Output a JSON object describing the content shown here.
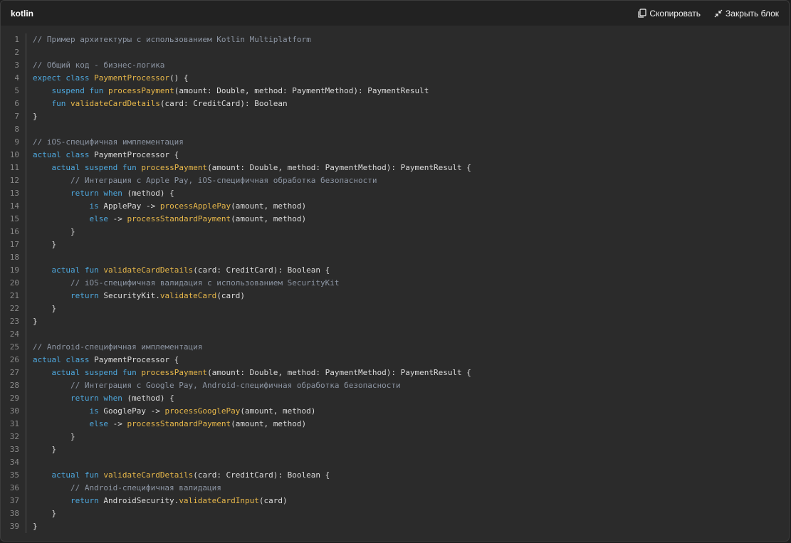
{
  "header": {
    "language": "kotlin",
    "copy_label": "Скопировать",
    "close_label": "Закрыть блок"
  },
  "code": {
    "lines": [
      [
        {
          "t": "c",
          "v": "// Пример архитектуры с использованием Kotlin Multiplatform"
        }
      ],
      [],
      [
        {
          "t": "c",
          "v": "// Общий код - бизнес-логика"
        }
      ],
      [
        {
          "t": "k",
          "v": "expect class "
        },
        {
          "t": "f",
          "v": "PaymentProcessor"
        },
        {
          "t": "p",
          "v": "() {"
        }
      ],
      [
        {
          "t": "p",
          "v": "    "
        },
        {
          "t": "k",
          "v": "suspend fun "
        },
        {
          "t": "f",
          "v": "processPayment"
        },
        {
          "t": "p",
          "v": "(amount: Double, method: PaymentMethod): PaymentResult"
        }
      ],
      [
        {
          "t": "p",
          "v": "    "
        },
        {
          "t": "k",
          "v": "fun "
        },
        {
          "t": "f",
          "v": "validateCardDetails"
        },
        {
          "t": "p",
          "v": "(card: CreditCard): Boolean"
        }
      ],
      [
        {
          "t": "p",
          "v": "}"
        }
      ],
      [],
      [
        {
          "t": "c",
          "v": "// iOS-специфичная имплементация"
        }
      ],
      [
        {
          "t": "k",
          "v": "actual class "
        },
        {
          "t": "p",
          "v": "PaymentProcessor {"
        }
      ],
      [
        {
          "t": "p",
          "v": "    "
        },
        {
          "t": "k",
          "v": "actual suspend fun "
        },
        {
          "t": "f",
          "v": "processPayment"
        },
        {
          "t": "p",
          "v": "(amount: Double, method: PaymentMethod): PaymentResult {"
        }
      ],
      [
        {
          "t": "p",
          "v": "        "
        },
        {
          "t": "c",
          "v": "// Интеграция с Apple Pay, iOS-специфичная обработка безопасности"
        }
      ],
      [
        {
          "t": "p",
          "v": "        "
        },
        {
          "t": "k",
          "v": "return when "
        },
        {
          "t": "p",
          "v": "(method) {"
        }
      ],
      [
        {
          "t": "p",
          "v": "            "
        },
        {
          "t": "k",
          "v": "is "
        },
        {
          "t": "p",
          "v": "ApplePay -> "
        },
        {
          "t": "f",
          "v": "processApplePay"
        },
        {
          "t": "p",
          "v": "(amount, method)"
        }
      ],
      [
        {
          "t": "p",
          "v": "            "
        },
        {
          "t": "k",
          "v": "else "
        },
        {
          "t": "p",
          "v": "-> "
        },
        {
          "t": "f",
          "v": "processStandardPayment"
        },
        {
          "t": "p",
          "v": "(amount, method)"
        }
      ],
      [
        {
          "t": "p",
          "v": "        }"
        }
      ],
      [
        {
          "t": "p",
          "v": "    }"
        }
      ],
      [],
      [
        {
          "t": "p",
          "v": "    "
        },
        {
          "t": "k",
          "v": "actual fun "
        },
        {
          "t": "f",
          "v": "validateCardDetails"
        },
        {
          "t": "p",
          "v": "(card: CreditCard): Boolean {"
        }
      ],
      [
        {
          "t": "p",
          "v": "        "
        },
        {
          "t": "c",
          "v": "// iOS-специфичная валидация с использованием SecurityKit"
        }
      ],
      [
        {
          "t": "p",
          "v": "        "
        },
        {
          "t": "k",
          "v": "return "
        },
        {
          "t": "p",
          "v": "SecurityKit."
        },
        {
          "t": "f",
          "v": "validateCard"
        },
        {
          "t": "p",
          "v": "(card)"
        }
      ],
      [
        {
          "t": "p",
          "v": "    }"
        }
      ],
      [
        {
          "t": "p",
          "v": "}"
        }
      ],
      [],
      [
        {
          "t": "c",
          "v": "// Android-специфичная имплементация"
        }
      ],
      [
        {
          "t": "k",
          "v": "actual class "
        },
        {
          "t": "p",
          "v": "PaymentProcessor {"
        }
      ],
      [
        {
          "t": "p",
          "v": "    "
        },
        {
          "t": "k",
          "v": "actual suspend fun "
        },
        {
          "t": "f",
          "v": "processPayment"
        },
        {
          "t": "p",
          "v": "(amount: Double, method: PaymentMethod): PaymentResult {"
        }
      ],
      [
        {
          "t": "p",
          "v": "        "
        },
        {
          "t": "c",
          "v": "// Интеграция с Google Pay, Android-специфичная обработка безопасности"
        }
      ],
      [
        {
          "t": "p",
          "v": "        "
        },
        {
          "t": "k",
          "v": "return when "
        },
        {
          "t": "p",
          "v": "(method) {"
        }
      ],
      [
        {
          "t": "p",
          "v": "            "
        },
        {
          "t": "k",
          "v": "is "
        },
        {
          "t": "p",
          "v": "GooglePay -> "
        },
        {
          "t": "f",
          "v": "processGooglePay"
        },
        {
          "t": "p",
          "v": "(amount, method)"
        }
      ],
      [
        {
          "t": "p",
          "v": "            "
        },
        {
          "t": "k",
          "v": "else "
        },
        {
          "t": "p",
          "v": "-> "
        },
        {
          "t": "f",
          "v": "processStandardPayment"
        },
        {
          "t": "p",
          "v": "(amount, method)"
        }
      ],
      [
        {
          "t": "p",
          "v": "        }"
        }
      ],
      [
        {
          "t": "p",
          "v": "    }"
        }
      ],
      [],
      [
        {
          "t": "p",
          "v": "    "
        },
        {
          "t": "k",
          "v": "actual fun "
        },
        {
          "t": "f",
          "v": "validateCardDetails"
        },
        {
          "t": "p",
          "v": "(card: CreditCard): Boolean {"
        }
      ],
      [
        {
          "t": "p",
          "v": "        "
        },
        {
          "t": "c",
          "v": "// Android-специфичная валидация"
        }
      ],
      [
        {
          "t": "p",
          "v": "        "
        },
        {
          "t": "k",
          "v": "return "
        },
        {
          "t": "p",
          "v": "AndroidSecurity."
        },
        {
          "t": "f",
          "v": "validateCardInput"
        },
        {
          "t": "p",
          "v": "(card)"
        }
      ],
      [
        {
          "t": "p",
          "v": "    }"
        }
      ],
      [
        {
          "t": "p",
          "v": "}"
        }
      ]
    ]
  },
  "colors": {
    "comment": "#8c95a3",
    "keyword": "#4ea8de",
    "function": "#e8b84a",
    "plain": "#dcdcdc",
    "background": "#2b2b2b",
    "header_background": "#222222"
  },
  "icons": {
    "copy": "copy-icon",
    "close": "collapse-icon"
  }
}
